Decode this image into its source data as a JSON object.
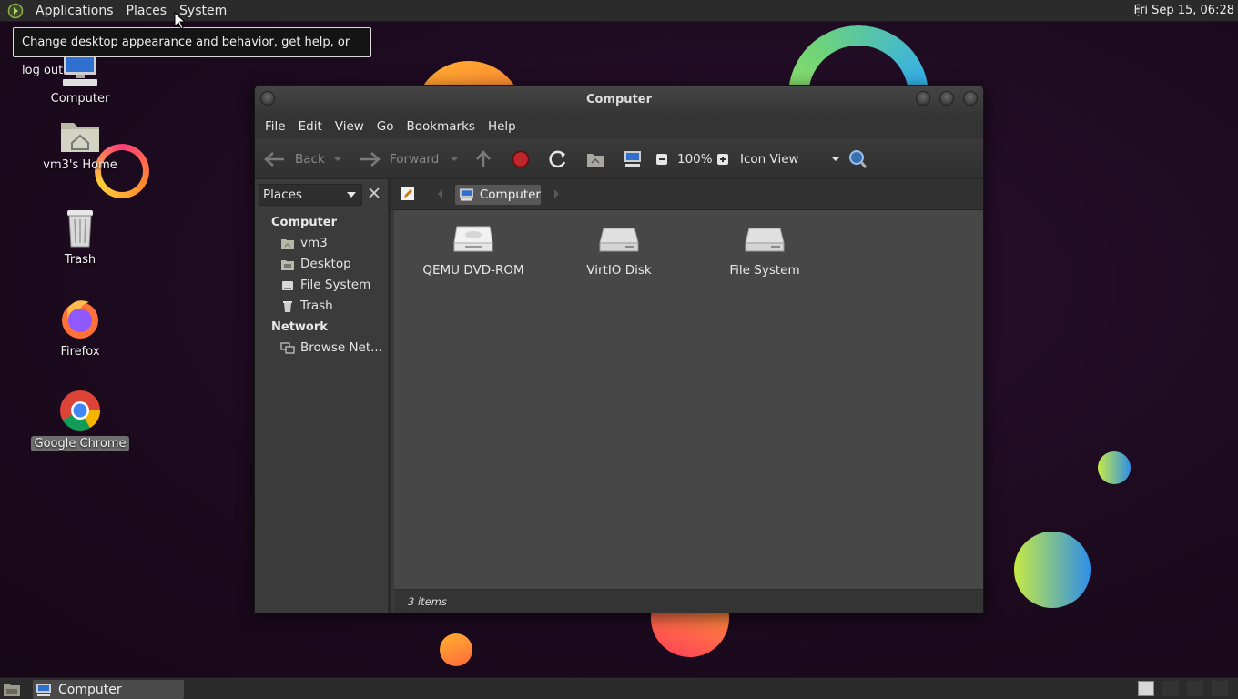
{
  "top_panel": {
    "menus": [
      "Applications",
      "Places",
      "System"
    ],
    "clock": "Fri Sep 15, 06:28"
  },
  "tooltip": "Change desktop appearance and behavior, get help, or log out",
  "desktop_icons": [
    {
      "label": "Computer",
      "icon": "computer-icon"
    },
    {
      "label": "vm3's Home",
      "icon": "home-folder-icon"
    },
    {
      "label": "Trash",
      "icon": "trash-icon"
    },
    {
      "label": "Firefox",
      "icon": "firefox-icon"
    },
    {
      "label": "Google Chrome",
      "icon": "chrome-icon"
    }
  ],
  "window": {
    "title": "Computer",
    "menu": [
      "File",
      "Edit",
      "View",
      "Go",
      "Bookmarks",
      "Help"
    ],
    "toolbar": {
      "back": "Back",
      "forward": "Forward",
      "zoom": "100%",
      "view_mode": "Icon View"
    },
    "location": "Computer",
    "sidebar": {
      "selector": "Places",
      "sections": [
        {
          "header": "Computer",
          "items": [
            "vm3",
            "Desktop",
            "File System",
            "Trash"
          ]
        },
        {
          "header": "Network",
          "items": [
            "Browse Net..."
          ]
        }
      ]
    },
    "items": [
      {
        "label": "QEMU DVD-ROM",
        "icon": "optical-drive-icon"
      },
      {
        "label": "VirtIO Disk",
        "icon": "hard-disk-icon"
      },
      {
        "label": "File System",
        "icon": "hard-disk-icon"
      }
    ],
    "status": "3 items"
  },
  "taskbar": {
    "tasks": [
      "Computer"
    ]
  },
  "colors": {
    "panel": "#2b2b2b",
    "window_bg": "#474747",
    "desktop": "#1d0b1f",
    "stop_red": "#c0272d"
  }
}
